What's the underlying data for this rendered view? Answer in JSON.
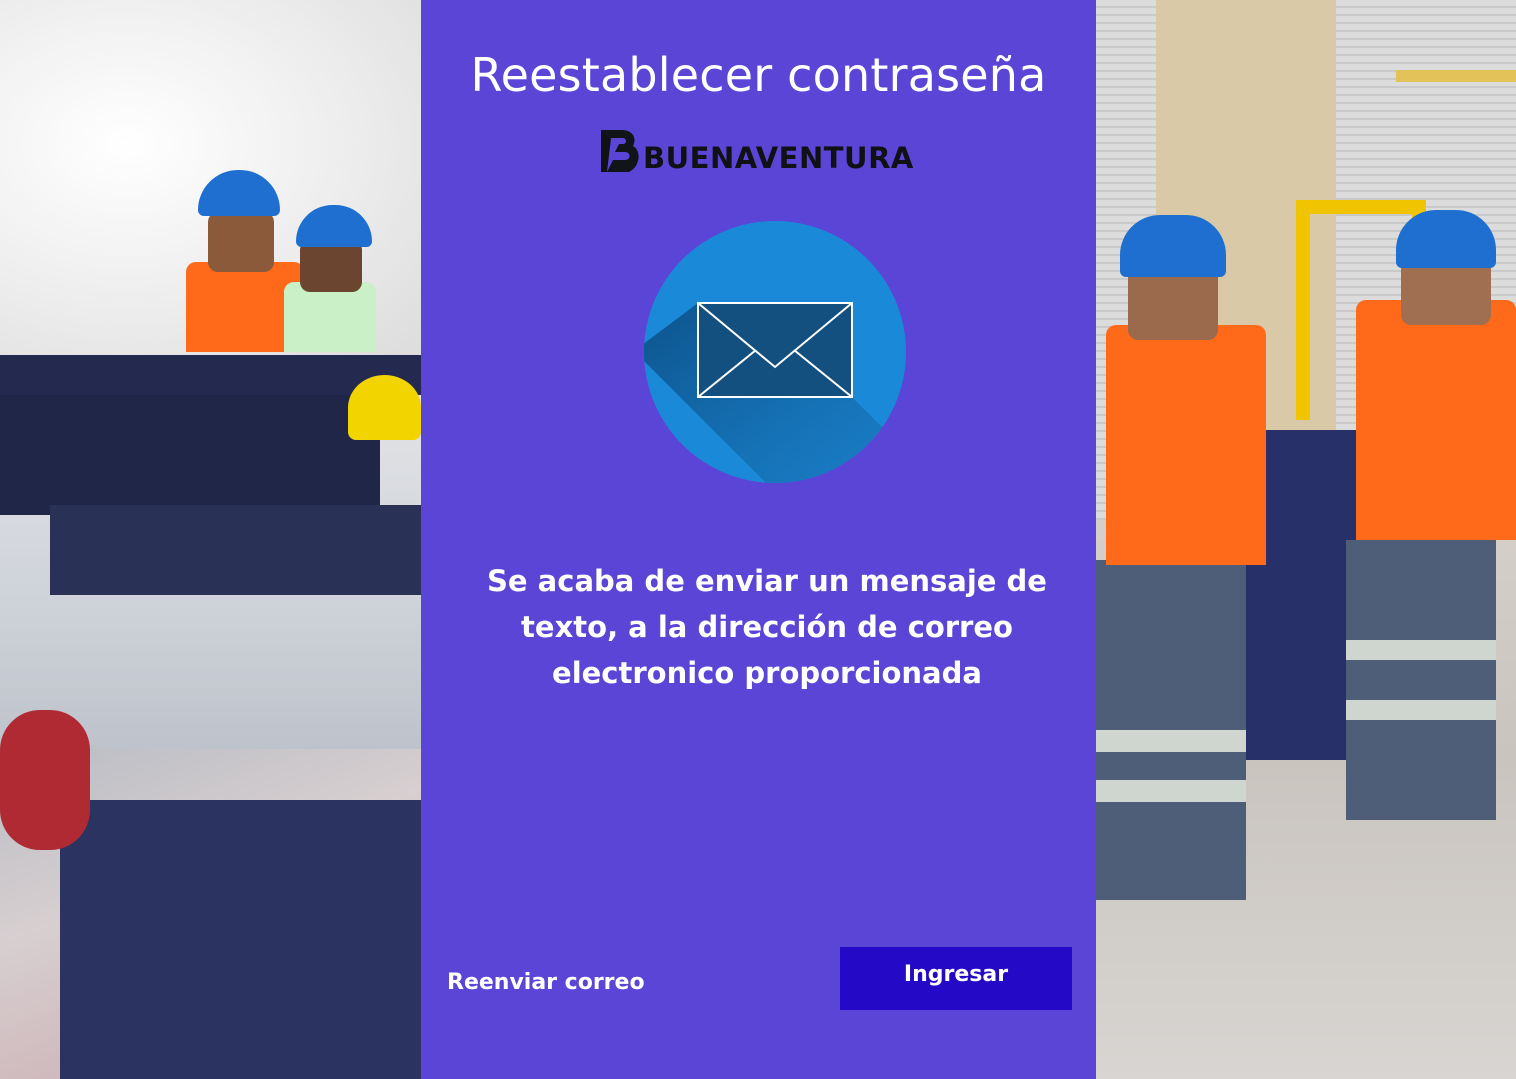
{
  "panel": {
    "title": "Reestablecer contraseña",
    "logo_text": "BUENAVENTURA",
    "message": "Se acaba de enviar un mensaje de texto, a la dirección de correo electronico proporcionada",
    "mail_icon": "envelope-icon",
    "background_color": "#5b45d6"
  },
  "actions": {
    "resend_label": "Reenviar correo",
    "login_label": "Ingresar",
    "login_color": "#2409c6"
  },
  "images": {
    "left_photo": "miners-with-equipment-photo",
    "right_photo": "workers-in-warehouse-photo"
  }
}
